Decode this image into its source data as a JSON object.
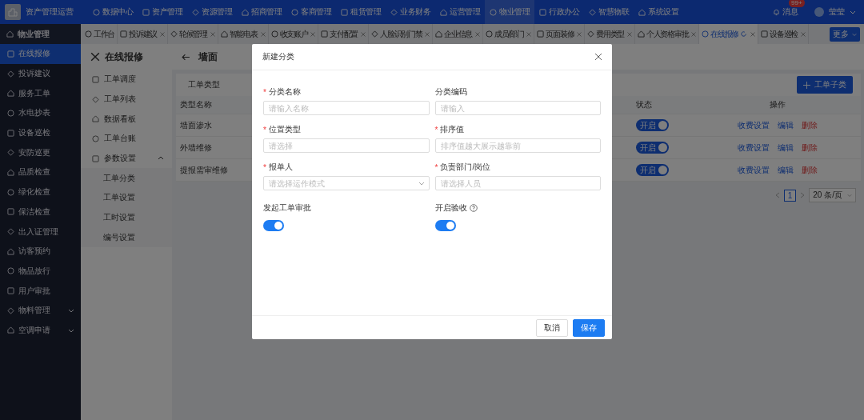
{
  "app": {
    "logo_text": "资产管理运营"
  },
  "top_nav": [
    {
      "label": "数据中心",
      "selected": false
    },
    {
      "label": "资产管理",
      "selected": false
    },
    {
      "label": "资源管理",
      "selected": false
    },
    {
      "label": "招商管理",
      "selected": false
    },
    {
      "label": "客商管理",
      "selected": false
    },
    {
      "label": "租赁管理",
      "selected": false
    },
    {
      "label": "业务财务",
      "selected": false
    },
    {
      "label": "运营管理",
      "selected": false
    },
    {
      "label": "物业管理",
      "selected": true
    },
    {
      "label": "行政办公",
      "selected": false
    },
    {
      "label": "智慧物联",
      "selected": false
    },
    {
      "label": "系统设置",
      "selected": false
    }
  ],
  "notifications": {
    "label": "消息",
    "badge": "99+"
  },
  "user": {
    "name": "莹莹"
  },
  "sidebar": {
    "title": "物业管理",
    "items": [
      {
        "label": "在线报修",
        "kind": "link",
        "selected": true
      },
      {
        "label": "投诉建议",
        "kind": "link",
        "selected": false
      },
      {
        "label": "服务工单",
        "kind": "link",
        "selected": false
      },
      {
        "label": "水电抄表",
        "kind": "link",
        "selected": false
      },
      {
        "label": "设备巡检",
        "kind": "link",
        "selected": false
      },
      {
        "label": "安防巡更",
        "kind": "link",
        "selected": false
      },
      {
        "label": "品质检查",
        "kind": "link",
        "selected": false
      },
      {
        "label": "绿化检查",
        "kind": "link",
        "selected": false
      },
      {
        "label": "保洁检查",
        "kind": "link",
        "selected": false
      },
      {
        "label": "出入证管理",
        "kind": "link",
        "selected": false
      },
      {
        "label": "访客预约",
        "kind": "link",
        "selected": false
      },
      {
        "label": "物品放行",
        "kind": "link",
        "selected": false
      },
      {
        "label": "用户审批",
        "kind": "link",
        "selected": false
      },
      {
        "label": "物料管理",
        "kind": "group",
        "selected": false,
        "expanded": false
      },
      {
        "label": "空调申请",
        "kind": "group",
        "selected": false,
        "expanded": false
      }
    ]
  },
  "tabs": [
    {
      "label": "工作台",
      "selected": false,
      "closable": false
    },
    {
      "label": "投诉建议",
      "selected": false,
      "closable": true
    },
    {
      "label": "轮候管理",
      "selected": false,
      "closable": true
    },
    {
      "label": "智能电表",
      "selected": false,
      "closable": true
    },
    {
      "label": "收支账户",
      "selected": false,
      "closable": true
    },
    {
      "label": "支付配置",
      "selected": false,
      "closable": true
    },
    {
      "label": "人脸识别门禁",
      "selected": false,
      "closable": true
    },
    {
      "label": "企业信息",
      "selected": false,
      "closable": true
    },
    {
      "label": "成员/部门",
      "selected": false,
      "closable": true
    },
    {
      "label": "页面装修",
      "selected": false,
      "closable": true
    },
    {
      "label": "费用类型",
      "selected": false,
      "closable": true
    },
    {
      "label": "个人资格审批",
      "selected": false,
      "closable": true
    },
    {
      "label": "在线报修",
      "selected": true,
      "closable": true
    },
    {
      "label": "设备巡检",
      "selected": false,
      "closable": true
    }
  ],
  "more_button": "更多",
  "submenu": {
    "title": "在线报修",
    "items": [
      {
        "label": "工单调度"
      },
      {
        "label": "工单列表"
      },
      {
        "label": "数据看板"
      },
      {
        "label": "工单台账"
      },
      {
        "label": "参数设置",
        "expanded": true,
        "children": [
          {
            "label": "工单分类"
          },
          {
            "label": "工单设置"
          },
          {
            "label": "工时设置"
          },
          {
            "label": "编号设置"
          }
        ]
      }
    ]
  },
  "page": {
    "title": "墙面"
  },
  "table": {
    "tab": "工单类型",
    "add_button": "工单子类",
    "columns": [
      "类型名称",
      "状态",
      "操作"
    ],
    "rows": [
      {
        "name": "墙面渗水",
        "status": {
          "label": "开启",
          "on": true
        },
        "actions": [
          "收费设置",
          "编辑",
          "删除"
        ]
      },
      {
        "name": "外墙维修",
        "status": {
          "label": "开启",
          "on": true
        },
        "actions": [
          "收费设置",
          "编辑",
          "删除"
        ]
      },
      {
        "name": "提报需审维修",
        "status": {
          "label": "开启",
          "on": true
        },
        "actions": [
          "收费设置",
          "编辑",
          "删除"
        ]
      }
    ]
  },
  "pagination": {
    "page": "1",
    "page_size": "20 条/页"
  },
  "modal": {
    "title": "新建分类",
    "required_mark": "*",
    "fields": [
      {
        "label": "分类名称",
        "required": true,
        "kind": "input",
        "placeholder": "请输入名称"
      },
      {
        "label": "分类编码",
        "required": false,
        "kind": "input",
        "placeholder": "请输入"
      },
      {
        "label": "位置类型",
        "required": true,
        "kind": "input",
        "placeholder": "请选择"
      },
      {
        "label": "排序值",
        "required": true,
        "kind": "input",
        "placeholder": "排序值越大展示越靠前"
      },
      {
        "label": "报单人",
        "required": true,
        "kind": "select",
        "placeholder": "请选择运作模式"
      },
      {
        "label": "负责部门/岗位",
        "required": true,
        "kind": "input",
        "placeholder": "请选择人员"
      }
    ],
    "switches": [
      {
        "label": "发起工单审批",
        "on": true,
        "help": false
      },
      {
        "label": "开启验收",
        "on": true,
        "help": true
      }
    ],
    "buttons": [
      {
        "label": "取消",
        "kind": "default"
      },
      {
        "label": "保存",
        "kind": "primary"
      }
    ]
  }
}
